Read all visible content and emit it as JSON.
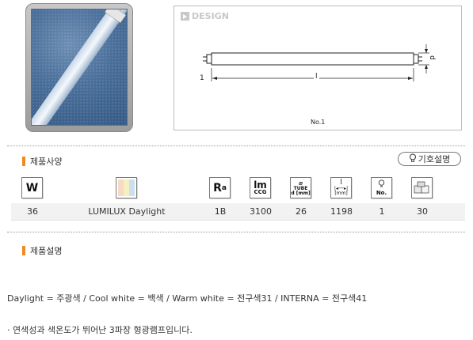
{
  "product": {
    "image_icon": "fluorescent-tube-photo"
  },
  "design": {
    "label": "DESIGN",
    "dim_l_left": "1",
    "dim_l_mid": "l",
    "dim_d": "d",
    "drawing_no": "No.1"
  },
  "specs": {
    "title": "제품사양",
    "legend_button": "기호설명",
    "icons": {
      "wattage": "W",
      "ra": "R",
      "ra_sub": "a",
      "lm_top": "lm",
      "lm_bottom": "CCG",
      "tube_top": "TUBE",
      "tube_bottom": "d [mm]",
      "length_top": "l",
      "length_bottom": "[mm]",
      "no": "No.",
      "color_swatches": [
        "#f7d9c4",
        "#f5f0c0",
        "#c9e0f2"
      ]
    },
    "row": {
      "wattage": "36",
      "name": "LUMILUX Daylight",
      "ra": "1B",
      "lumen": "3100",
      "tube_d": "26",
      "length": "1198",
      "no": "1",
      "pack": "30"
    }
  },
  "description": {
    "title": "제품설명",
    "line1": "Daylight = 주광색 / Cool white = 백색 / Warm white = 전구색31 / INTERNA = 전구색41",
    "line2": "· 연색성과 색온도가 뛰어난 3파장 형광램프입니다."
  },
  "colors": {
    "accent_orange": "#f08a1c"
  }
}
